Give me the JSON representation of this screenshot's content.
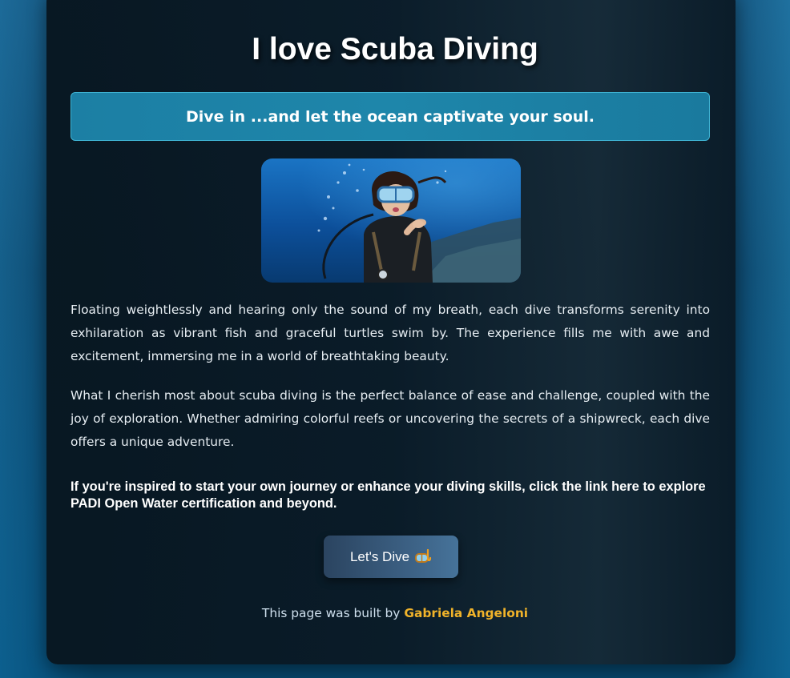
{
  "page": {
    "title": "I love Scuba Diving",
    "banner": "Dive in ...and let the ocean captivate your soul.",
    "paragraphs": [
      "Floating weightlessly and hearing only the sound of my breath, each dive transforms serenity into exhilaration as vibrant fish and graceful turtles swim by. The experience fills me with awe and excitement, immersing me in a world of breathtaking beauty.",
      "What I cherish most about scuba diving is the perfect balance of ease and challenge, coupled with the joy of exploration. Whether admiring colorful reefs or uncovering the secrets of a shipwreck, each dive offers a unique adventure."
    ],
    "cta": "If you're inspired to start your own journey or enhance your diving skills, click the link here to explore PADI Open Water certification and beyond.",
    "button": {
      "label": "Let's Dive",
      "icon": "diving-mask-icon"
    },
    "footer": {
      "prefix": "This page was built by",
      "author": "Gabriela Angeloni"
    },
    "image": {
      "icon": "scuba-diver-photo"
    }
  },
  "colors": {
    "banner_bg": "#1e86aa",
    "banner_border": "#3fb3d3",
    "author_link": "#f0b32a",
    "card_bg": "#0a1a26",
    "button_bg": "#3b5f82"
  }
}
